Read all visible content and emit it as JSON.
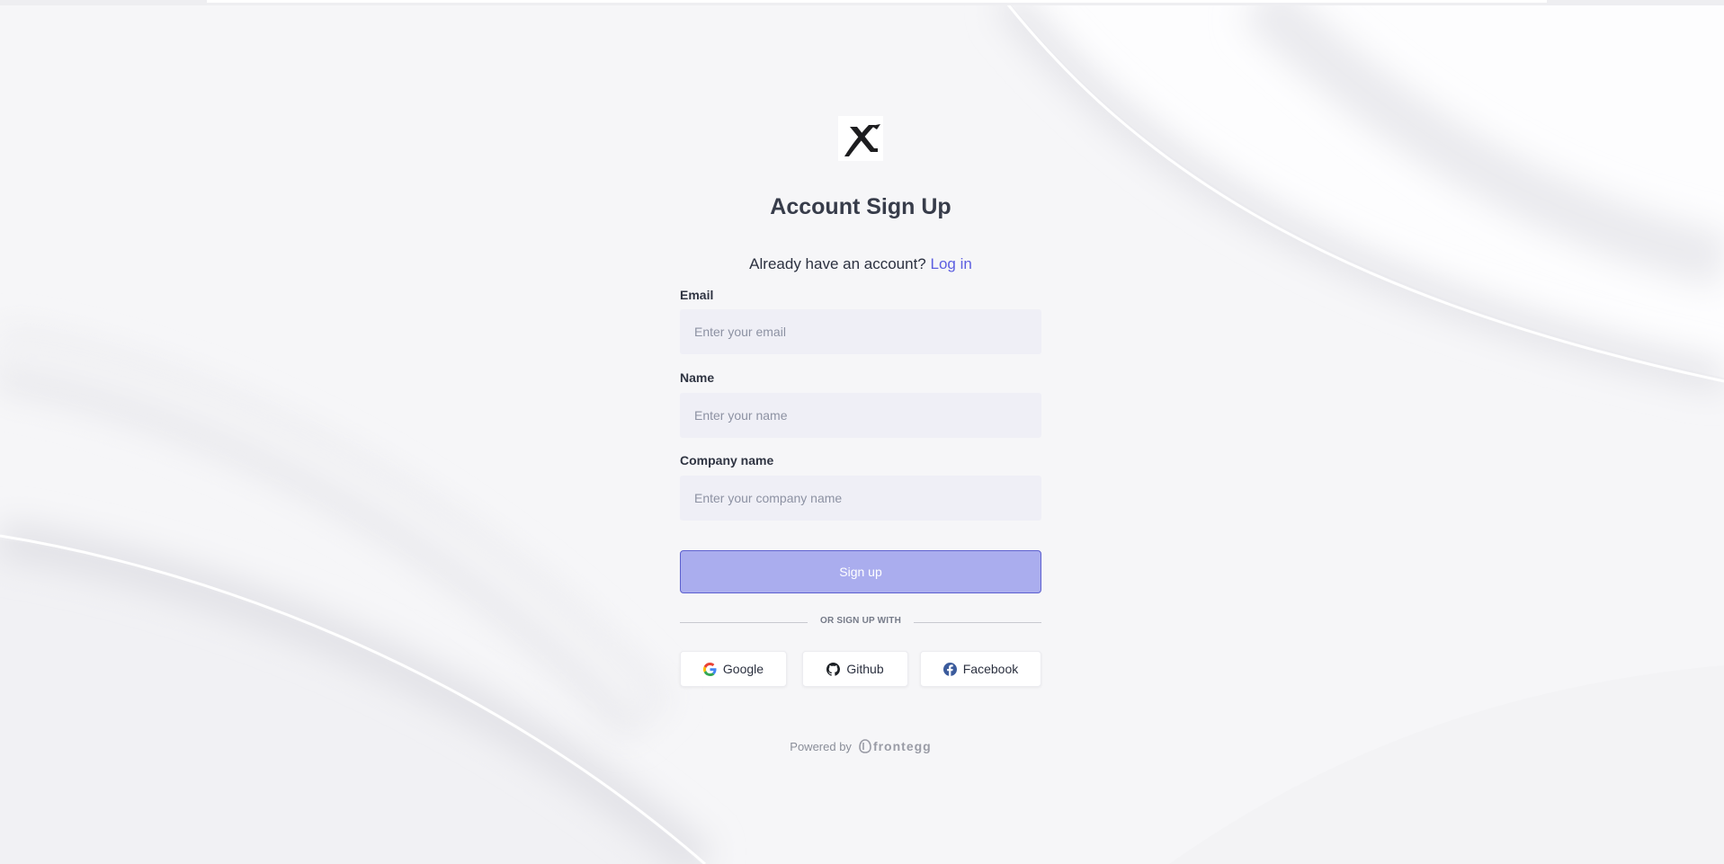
{
  "app": {
    "title": "Account Sign Up",
    "logo_icon": "x-brand-logo"
  },
  "login_prompt": {
    "text": "Already have an account?",
    "link_label": "Log in"
  },
  "form": {
    "email": {
      "label": "Email",
      "placeholder": "Enter your email",
      "value": ""
    },
    "name": {
      "label": "Name",
      "placeholder": "Enter your name",
      "value": ""
    },
    "company": {
      "label": "Company name",
      "placeholder": "Enter your company name",
      "value": ""
    },
    "submit_label": "Sign up"
  },
  "divider_text": "OR SIGN UP WITH",
  "social": [
    {
      "label": "Google",
      "icon": "google-icon"
    },
    {
      "label": "Github",
      "icon": "github-icon"
    },
    {
      "label": "Facebook",
      "icon": "facebook-icon"
    }
  ],
  "footer": {
    "powered_by": "Powered by",
    "brand": "frontegg"
  },
  "colors": {
    "accent": "#5c5ee0",
    "button_disabled": "#aaadee",
    "input_bg": "#efeff6",
    "heading": "#373c4a"
  }
}
